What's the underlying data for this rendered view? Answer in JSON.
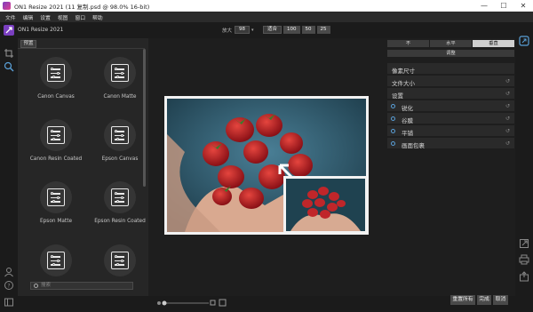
{
  "window": {
    "title": "ON1 Resize 2021 (11 复制.psd @ 98.0% 16-bit)",
    "minimize": "—",
    "maximize": "☐",
    "close": "✕"
  },
  "menu": [
    "文件",
    "编辑",
    "设置",
    "视图",
    "窗口",
    "帮助"
  ],
  "app": {
    "name": "ON1 Resize 2021"
  },
  "zoom": {
    "label": "放大",
    "value": "98",
    "fit_label": "适合",
    "presets": [
      "100",
      "50",
      "25"
    ]
  },
  "left_panel": {
    "tab": "预置",
    "presets": [
      {
        "name": "Canon Canvas"
      },
      {
        "name": "Canon Matte"
      },
      {
        "name": "Canon Resin Coated"
      },
      {
        "name": "Epson Canvas"
      },
      {
        "name": "Epson Matte"
      },
      {
        "name": "Epson Resin Coated"
      },
      {
        "name": ""
      },
      {
        "name": ""
      }
    ],
    "search_placeholder": "搜索"
  },
  "right_panel": {
    "segments": [
      "不",
      "水平",
      "垂直"
    ],
    "active_segment": 2,
    "adjust_label": "调整",
    "sections": [
      {
        "label": "像素尺寸",
        "reset": false,
        "dot": false
      },
      {
        "label": "文件大小",
        "reset": true,
        "dot": false
      },
      {
        "label": "设置",
        "reset": true,
        "dot": false
      },
      {
        "label": "锐化",
        "reset": true,
        "dot": true
      },
      {
        "label": "谷膜",
        "reset": true,
        "dot": true
      },
      {
        "label": "平铺",
        "reset": true,
        "dot": true
      },
      {
        "label": "画面包裹",
        "reset": true,
        "dot": true
      }
    ]
  },
  "bottom": {
    "reset_all": "重置所有",
    "done": "完成",
    "cancel": "取消"
  },
  "colors": {
    "accent": "#5aa0d8",
    "panel": "#262626",
    "strawberry": "#c0262a"
  }
}
